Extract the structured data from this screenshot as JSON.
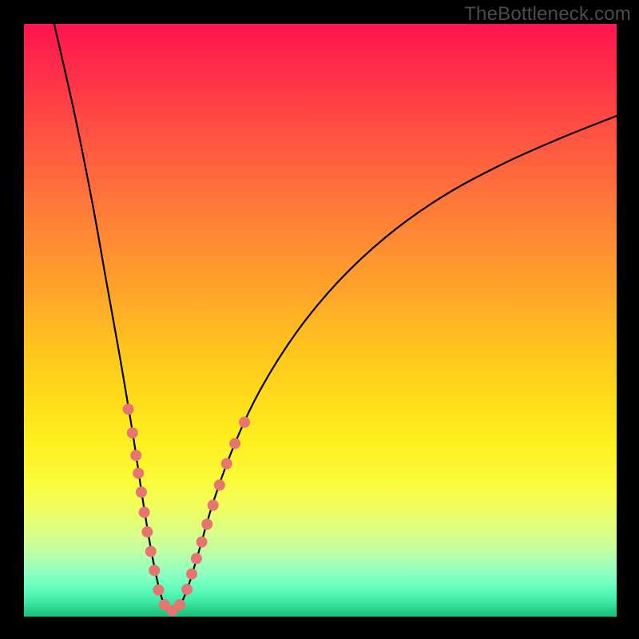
{
  "watermark": "TheBottleneck.com",
  "chart_data": {
    "type": "line",
    "title": "",
    "xlabel": "",
    "ylabel": "",
    "xlim": [
      0,
      100
    ],
    "ylim": [
      0,
      100
    ],
    "description": "Bottleneck-style V-curve: steep descending branch from upper-left to a minimum near x≈24, then rising concave branch to upper-right. Overlaid pink dots cluster on both branches near the bottom of the curve.",
    "curve_points": [
      {
        "x": 5.1,
        "y": 100.0
      },
      {
        "x": 8.5,
        "y": 85.0
      },
      {
        "x": 11.5,
        "y": 70.0
      },
      {
        "x": 14.0,
        "y": 56.0
      },
      {
        "x": 16.5,
        "y": 42.0
      },
      {
        "x": 18.5,
        "y": 30.0
      },
      {
        "x": 20.0,
        "y": 20.0
      },
      {
        "x": 21.5,
        "y": 11.0
      },
      {
        "x": 23.0,
        "y": 4.0
      },
      {
        "x": 24.3,
        "y": 1.0
      },
      {
        "x": 25.8,
        "y": 1.2
      },
      {
        "x": 27.5,
        "y": 4.5
      },
      {
        "x": 29.5,
        "y": 11.0
      },
      {
        "x": 32.0,
        "y": 19.5
      },
      {
        "x": 35.5,
        "y": 29.0
      },
      {
        "x": 40.0,
        "y": 38.5
      },
      {
        "x": 46.0,
        "y": 48.0
      },
      {
        "x": 53.0,
        "y": 56.5
      },
      {
        "x": 61.0,
        "y": 64.0
      },
      {
        "x": 70.0,
        "y": 70.5
      },
      {
        "x": 80.0,
        "y": 76.0
      },
      {
        "x": 90.0,
        "y": 80.5
      },
      {
        "x": 100.0,
        "y": 84.5
      }
    ],
    "dots": [
      {
        "x": 17.6,
        "y": 35.0
      },
      {
        "x": 18.3,
        "y": 31.0
      },
      {
        "x": 18.9,
        "y": 27.2
      },
      {
        "x": 19.3,
        "y": 24.2
      },
      {
        "x": 19.8,
        "y": 21.0
      },
      {
        "x": 20.3,
        "y": 17.6
      },
      {
        "x": 20.8,
        "y": 14.3
      },
      {
        "x": 21.4,
        "y": 11.0
      },
      {
        "x": 22.0,
        "y": 7.8
      },
      {
        "x": 22.7,
        "y": 4.5
      },
      {
        "x": 23.7,
        "y": 2.0
      },
      {
        "x": 25.0,
        "y": 1.0
      },
      {
        "x": 26.3,
        "y": 2.0
      },
      {
        "x": 27.5,
        "y": 4.6
      },
      {
        "x": 28.3,
        "y": 7.2
      },
      {
        "x": 29.1,
        "y": 9.8
      },
      {
        "x": 30.0,
        "y": 12.6
      },
      {
        "x": 30.9,
        "y": 15.6
      },
      {
        "x": 31.9,
        "y": 18.8
      },
      {
        "x": 33.0,
        "y": 22.2
      },
      {
        "x": 34.2,
        "y": 25.8
      },
      {
        "x": 35.6,
        "y": 29.2
      },
      {
        "x": 37.2,
        "y": 32.8
      }
    ],
    "dot_radius_px": 7,
    "gradient_stops": [
      {
        "pos": 0.0,
        "color": "#ff1450"
      },
      {
        "pos": 0.3,
        "color": "#ff7a38"
      },
      {
        "pos": 0.6,
        "color": "#ffd21b"
      },
      {
        "pos": 0.8,
        "color": "#f2ff4d"
      },
      {
        "pos": 0.92,
        "color": "#a5ffb6"
      },
      {
        "pos": 1.0,
        "color": "#1ec07b"
      }
    ]
  }
}
